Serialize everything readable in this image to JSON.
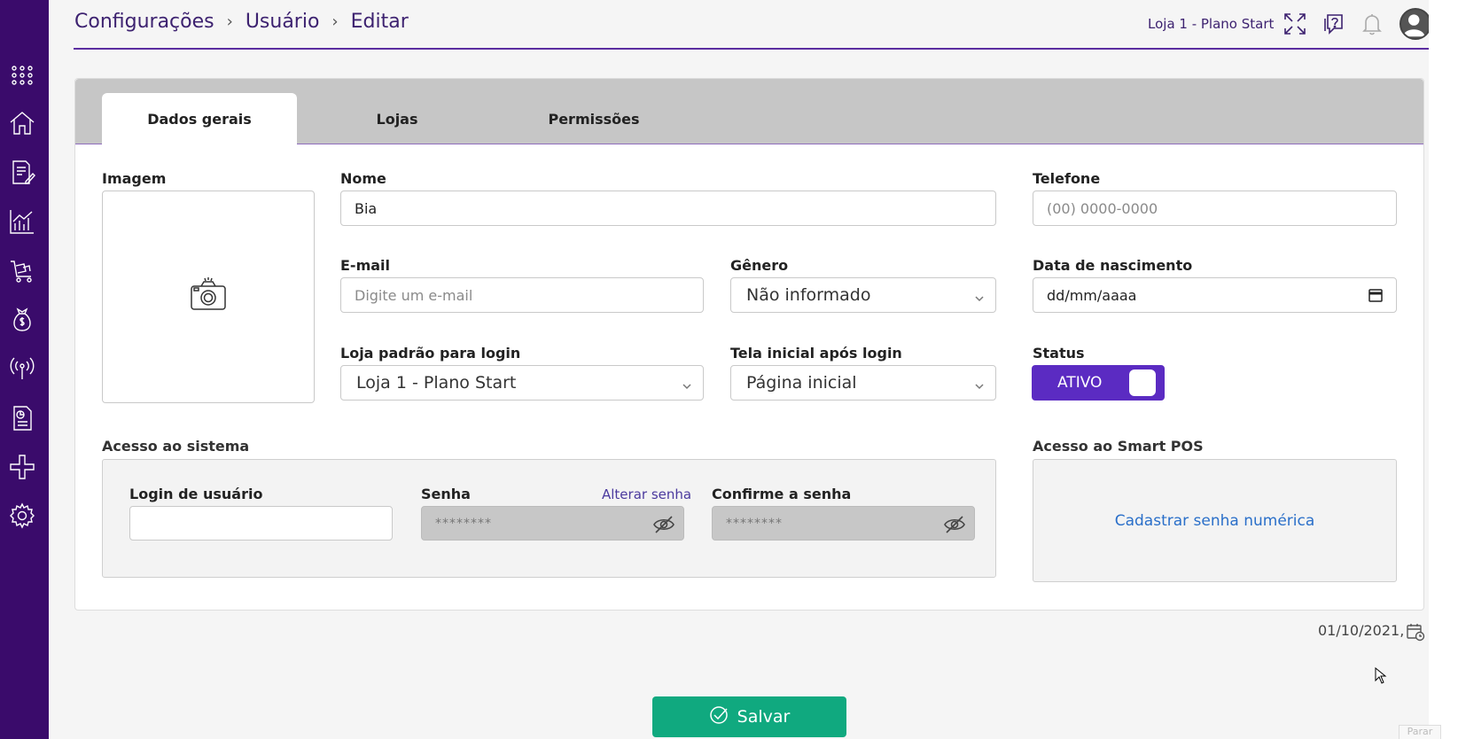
{
  "breadcrumb": [
    "Configurações",
    "Usuário",
    "Editar"
  ],
  "topbar": {
    "store": "Loja 1 - Plano Start"
  },
  "tabs": [
    {
      "label": "Dados gerais",
      "active": true
    },
    {
      "label": "Lojas",
      "active": false
    },
    {
      "label": "Permissões",
      "active": false
    }
  ],
  "form": {
    "image_label": "Imagem",
    "name_label": "Nome",
    "name_value": "Bia",
    "phone_label": "Telefone",
    "phone_placeholder": "(00) 0000-0000",
    "email_label": "E-mail",
    "email_placeholder": "Digite um e-mail",
    "gender_label": "Gênero",
    "gender_value": "Não informado",
    "birth_label": "Data de nascimento",
    "birth_placeholder": "dd/mm/aaaa",
    "store_label": "Loja padrão para login",
    "store_value": "Loja 1 - Plano Start",
    "screen_label": "Tela inicial após login",
    "screen_value": "Página inicial",
    "status_label": "Status",
    "status_value": "ATIVO"
  },
  "access": {
    "title": "Acesso ao sistema",
    "login_label": "Login de usuário",
    "login_value": "",
    "password_label": "Senha",
    "change_password": "Alterar senha",
    "password_value": "********",
    "confirm_label": "Confirme a senha",
    "confirm_value": "********"
  },
  "pos": {
    "title": "Acesso ao Smart POS",
    "link": "Cadastrar senha numérica"
  },
  "footer": {
    "date": "01/10/2021,",
    "save": "Salvar",
    "stop": "Parar"
  },
  "colors": {
    "sidebar": "#3a0b6b",
    "accent": "#5b2bc2",
    "save": "#10a97f",
    "link": "#2a6fc9"
  },
  "icons": {
    "sidebar": [
      "apps-grid-icon",
      "home-icon",
      "document-edit-icon",
      "chart-icon",
      "cart-icon",
      "money-bag-icon",
      "broadcast-icon",
      "receipt-icon",
      "integration-icon",
      "gear-icon"
    ],
    "topbar": [
      "fullscreen-icon",
      "help-icon",
      "bell-icon",
      "user-avatar-icon"
    ]
  }
}
